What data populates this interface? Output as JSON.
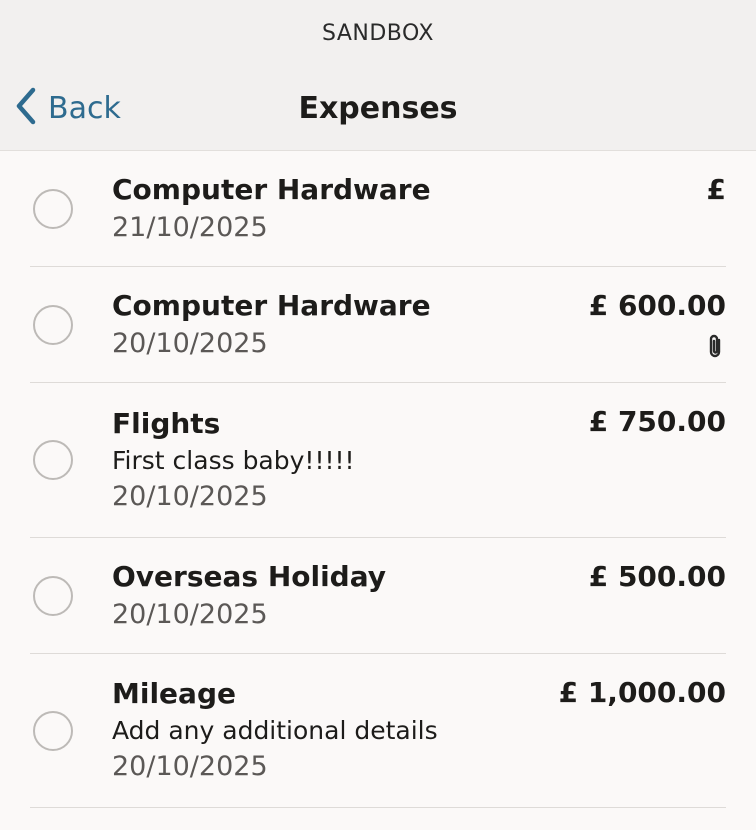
{
  "environment": {
    "label": "SANDBOX"
  },
  "header": {
    "back_label": "Back",
    "title": "Expenses"
  },
  "expenses": [
    {
      "title": "Computer Hardware",
      "description": "",
      "date": "21/10/2025",
      "amount": "£",
      "has_attachment": false
    },
    {
      "title": "Computer Hardware",
      "description": "",
      "date": "20/10/2025",
      "amount": "£ 600.00",
      "has_attachment": true
    },
    {
      "title": "Flights",
      "description": "First class baby!!!!!",
      "date": "20/10/2025",
      "amount": "£ 750.00",
      "has_attachment": false
    },
    {
      "title": "Overseas Holiday",
      "description": "",
      "date": "20/10/2025",
      "amount": "£ 500.00",
      "has_attachment": false
    },
    {
      "title": "Mileage",
      "description": "Add any additional details",
      "date": "20/10/2025",
      "amount": "£ 1,000.00",
      "has_attachment": false
    }
  ],
  "icons": {
    "back": "chevron-left-icon",
    "attachment": "paperclip-icon"
  },
  "colors": {
    "accent": "#2e6b8f",
    "header_bg": "#f2f0ef",
    "page_bg": "#fbf9f8"
  }
}
